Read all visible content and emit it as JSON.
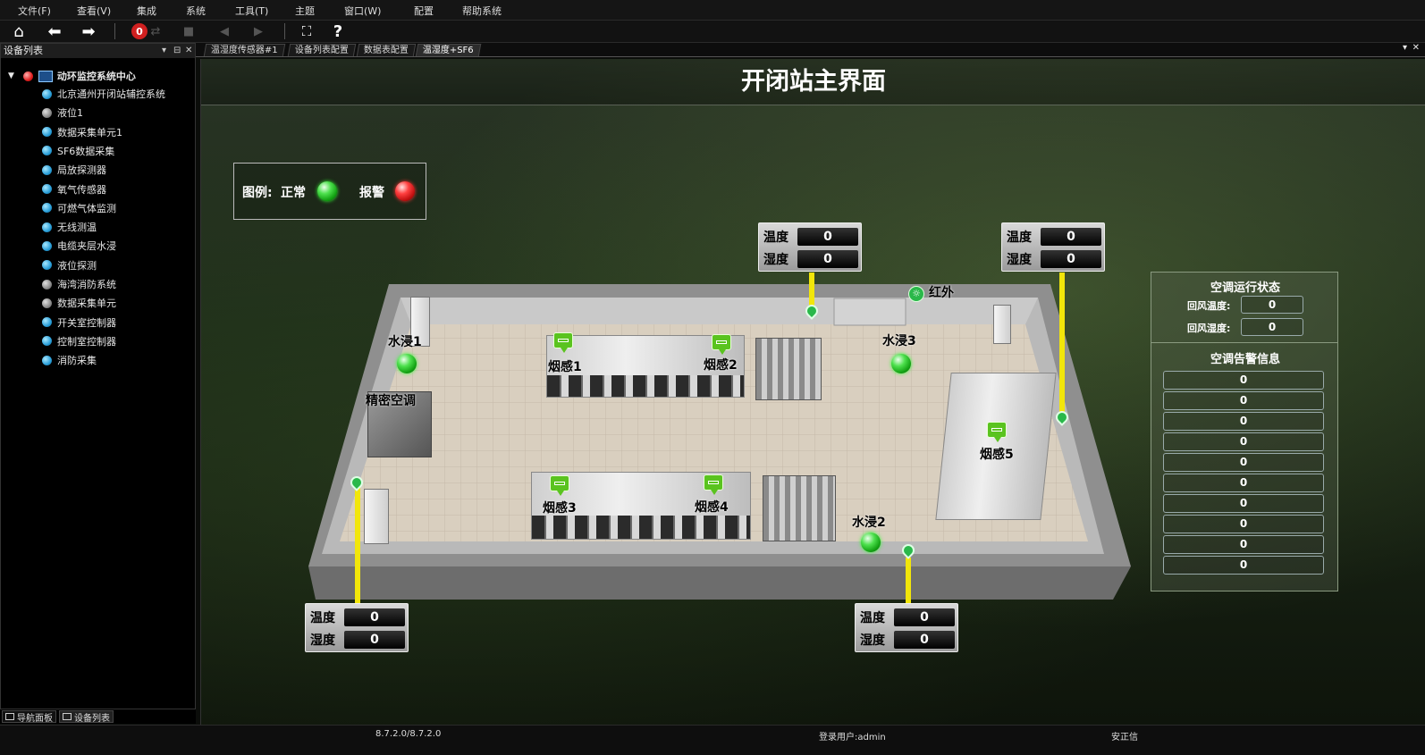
{
  "menu": [
    "文件(F)",
    "查看(V)",
    "集成",
    "系统",
    "工具(T)",
    "主题",
    "窗口(W)",
    "配置",
    "帮助系统"
  ],
  "toolbar": {
    "alarm_count": "0",
    "help_label": "?"
  },
  "left_panel": {
    "title": "设备列表",
    "root": "动环监控系统中心",
    "items": [
      {
        "label": "北京通州开闭站辅控系统",
        "status": "blue"
      },
      {
        "label": "液位1",
        "status": "gray"
      },
      {
        "label": "数据采集单元1",
        "status": "blue"
      },
      {
        "label": "SF6数据采集",
        "status": "blue"
      },
      {
        "label": "局放探测器",
        "status": "blue"
      },
      {
        "label": "氧气传感器",
        "status": "blue"
      },
      {
        "label": "可燃气体监测",
        "status": "blue"
      },
      {
        "label": "无线测温",
        "status": "blue"
      },
      {
        "label": "电缆夹层水浸",
        "status": "blue"
      },
      {
        "label": "液位探测",
        "status": "blue"
      },
      {
        "label": "海湾消防系统",
        "status": "gray"
      },
      {
        "label": "数据采集单元",
        "status": "gray"
      },
      {
        "label": "开关室控制器",
        "status": "blue"
      },
      {
        "label": "控制室控制器",
        "status": "blue"
      },
      {
        "label": "消防采集",
        "status": "blue"
      }
    ],
    "bottom_tabs": [
      "导航面板",
      "设备列表"
    ]
  },
  "doc_tabs": [
    "温湿度传感器#1",
    "设备列表配置",
    "数据表配置",
    "温湿度+SF6"
  ],
  "main": {
    "title": "开闭站主界面",
    "legend": {
      "prefix": "图例:",
      "normal": "正常",
      "alarm": "报警"
    },
    "sensors": [
      {
        "temp_label": "温度",
        "temp": "0",
        "hum_label": "湿度",
        "hum": "0"
      },
      {
        "temp_label": "温度",
        "temp": "0",
        "hum_label": "湿度",
        "hum": "0"
      },
      {
        "temp_label": "温度",
        "temp": "0",
        "hum_label": "湿度",
        "hum": "0"
      },
      {
        "temp_label": "温度",
        "temp": "0",
        "hum_label": "湿度",
        "hum": "0"
      }
    ],
    "room_labels": {
      "water1": "水浸1",
      "water2": "水浸2",
      "water3": "水浸3",
      "smoke1": "烟感1",
      "smoke2": "烟感2",
      "smoke3": "烟感3",
      "smoke4": "烟感4",
      "smoke5": "烟感5",
      "ac": "精密空调",
      "infrared": "红外"
    },
    "ac_panel": {
      "status_title": "空调运行状态",
      "rows": [
        {
          "label": "回风温度:",
          "value": "0"
        },
        {
          "label": "回风湿度:",
          "value": "0"
        }
      ],
      "alarm_title": "空调告警信息",
      "alarms": [
        "0",
        "0",
        "0",
        "0",
        "0",
        "0",
        "0",
        "0",
        "0",
        "0"
      ]
    }
  },
  "status_bar": {
    "version": "8.7.2.0/8.7.2.0",
    "user": "登录用户:admin",
    "company": "安正信"
  },
  "colors": {
    "normal": "#33cc33",
    "alarm": "#e02020",
    "pole": "#f2e60a",
    "marker": "#2ab84a"
  }
}
